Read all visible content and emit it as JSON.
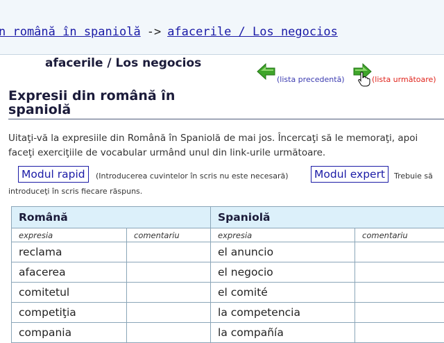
{
  "breadcrumb": {
    "parent": "n română în spaniolă",
    "separator": "->",
    "current": "afacerile / Los negocios"
  },
  "list_title": "afacerile / Los negocios",
  "nav": {
    "prev_label": "(lista precedentă)",
    "next_label": "(lista următoare)",
    "prev_color": "#3b3bb0",
    "next_color": "#e0241c"
  },
  "section": {
    "heading_line1": "Expresii din română în",
    "heading_line2": "spaniolă"
  },
  "intro": "Uitaţi-vă la expresiile din Română în Spaniolă de mai jos. Încercaţi să le memoraţi, apoi faceţi exerciţiile de vocabular urmând unul din link-urile următoare.",
  "modes": {
    "rapid_label": "Modul rapid",
    "rapid_note": "(Introducerea cuvintelor în scris nu este necesară)",
    "expert_label": "Modul expert",
    "expert_note_1": "Trebuie să",
    "expert_note_2": "introduceţi în scris fiecare răspuns."
  },
  "table": {
    "lang_left": "Română",
    "lang_right": "Spaniolă",
    "col_expr": "expresia",
    "col_comment": "comentariu",
    "rows": [
      {
        "ro": "reclama",
        "es": "el anuncio"
      },
      {
        "ro": "afacerea",
        "es": "el negocio"
      },
      {
        "ro": "comitetul",
        "es": "el comité"
      },
      {
        "ro": "competiţia",
        "es": "la competencia"
      },
      {
        "ro": "compania",
        "es": "la compañía"
      }
    ]
  },
  "colors": {
    "link": "#1a1aa6",
    "header_bg": "#dcf0fa",
    "arrow_green": "#3fa52a"
  }
}
